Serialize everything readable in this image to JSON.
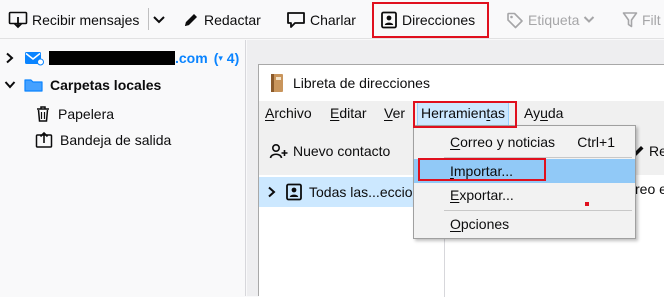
{
  "toolbar": {
    "get_messages": "Recibir mensajes",
    "write": "Redactar",
    "chat": "Charlar",
    "address_book": "Direcciones",
    "tag": "Etiqueta",
    "filter": "Filt"
  },
  "folders": {
    "account_suffix": ".com",
    "account_unread": "4",
    "local_folders": "Carpetas locales",
    "trash": "Papelera",
    "outbox": "Bandeja de salida"
  },
  "address_book": {
    "title": "Libreta de direcciones",
    "menu": {
      "file": "Archivo",
      "edit": "Editar",
      "view": "Ver",
      "tools": "Herramientas",
      "help": "Ayuda"
    },
    "new_contact": "Nuevo contacto",
    "all_books": "Todas las...eccio",
    "right_partial": "Re",
    "right_partial2": "reo e"
  },
  "tools_menu": {
    "mail_news": "Correo y noticias",
    "mail_news_shortcut": "Ctrl+1",
    "import": "Importar...",
    "export": "Exportar...",
    "options": "Opciones"
  },
  "colors": {
    "highlight_box": "#e0101e",
    "account_blue": "#0a84ff",
    "selection": "#cce8ff",
    "menu_hover": "#91c9f7"
  }
}
